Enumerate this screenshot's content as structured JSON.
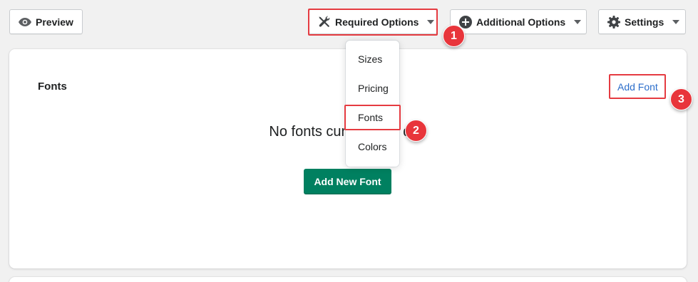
{
  "toolbar": {
    "preview_label": "Preview",
    "required_label": "Required Options",
    "additional_label": "Additional Options",
    "settings_label": "Settings"
  },
  "card": {
    "title": "Fonts",
    "link_label": "Add Font",
    "empty_text_before": "No fonts cur",
    "empty_text_after": "ded",
    "primary_label": "Add New Font"
  },
  "menu": {
    "items": [
      {
        "label": "Sizes"
      },
      {
        "label": "Pricing"
      },
      {
        "label": "Fonts"
      },
      {
        "label": "Colors"
      }
    ]
  },
  "annotations": {
    "badges": [
      "1",
      "2",
      "3"
    ],
    "color": "#e53b41"
  },
  "colors": {
    "primary": "#008060",
    "link": "#2c6ecb"
  }
}
